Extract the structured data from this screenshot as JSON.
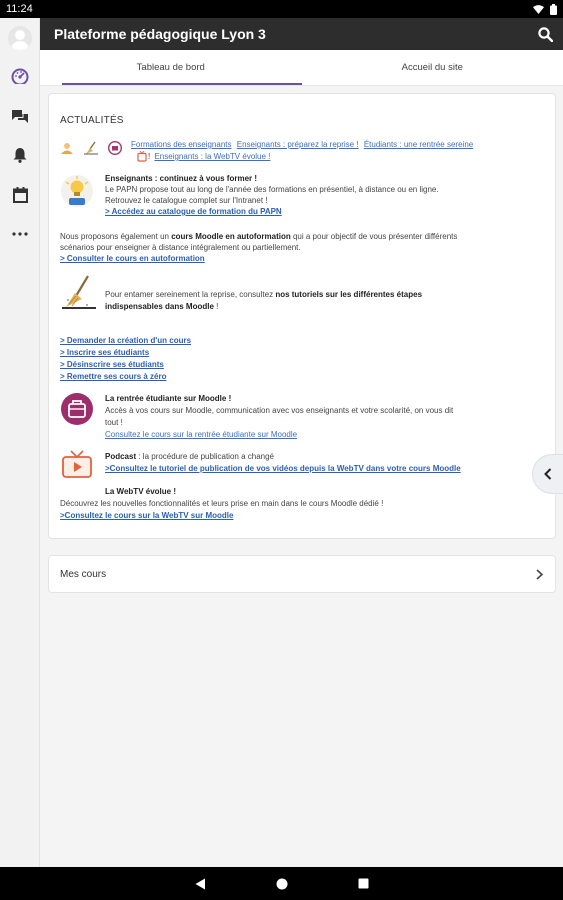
{
  "status_bar": {
    "time": "11:24"
  },
  "header": {
    "title": "Plateforme pédagogique Lyon 3"
  },
  "tabs": [
    {
      "label": "Tableau de bord",
      "active": true
    },
    {
      "label": "Accueil du site",
      "active": false
    }
  ],
  "news": {
    "title": "ACTUALITÉS",
    "links_row1": [
      "Formations des enseignants",
      "Enseignants : préparez la reprise !",
      "Étudiants : une rentrée sereine"
    ],
    "links_row2": [
      "Enseignants : la WebTV évolue !"
    ],
    "section1": {
      "heading": "Enseignants : continuez à vous former !",
      "line1": "Le PAPN propose tout au long de l'année des formations en présentiel, à distance ou en ligne.",
      "line2": "Retrouvez le catalogue complet sur l'Intranet !",
      "link": "> Accédez au catalogue de formation du PAPN"
    },
    "section2": {
      "line1_a": "Nous proposons également un ",
      "line1_b": "cours Moodle en autoformation",
      "line1_c": " qui a pour objectif de vous présenter différents",
      "line2": "scénarios pour enseigner à distance intégralement ou partiellement.",
      "link": "> Consulter le cours en autoformation"
    },
    "section3": {
      "line1_a": "Pour entamer sereinement la reprise, consultez ",
      "line1_b": "nos tutoriels sur les différentes étapes",
      "line2": "indispensables dans Moodle",
      "line2_c": " !"
    },
    "actions": [
      "> Demander la création d'un cours",
      "> Inscrire ses étudiants",
      "> Désinscrire ses étudiants",
      "> Remettre ses cours à zéro"
    ],
    "section4": {
      "heading": "La rentrée étudiante sur Moodle !",
      "line1": "Accès à vos cours sur Moodle, communication avec vos enseignants et votre scolarité, on vous dit",
      "line2": "tout !",
      "link": "Consultez le cours sur la rentrée étudiante sur Moodle"
    },
    "section5": {
      "label": "Podcast",
      "text": " : la procédure de publication a changé",
      "link": ">Consultez le tutoriel de publication de vos vidéos depuis la WebTV dans votre cours Moodle"
    },
    "section6": {
      "heading": "La WebTV évolue !",
      "line1": "Découvrez les nouvelles fonctionnalités et leurs prise en main dans le cours Moodle dédié !",
      "link": ">Consultez le cours sur la WebTV sur Moodle"
    }
  },
  "my_courses": {
    "label": "Mes cours"
  },
  "sidebar": {
    "items": [
      "avatar",
      "dashboard-icon",
      "messages-icon",
      "notifications-icon",
      "calendar-icon",
      "more-icon"
    ]
  },
  "colors": {
    "accent": "#6d4fa8",
    "link": "#3a6fc4",
    "topbar": "#2d2d2d"
  }
}
